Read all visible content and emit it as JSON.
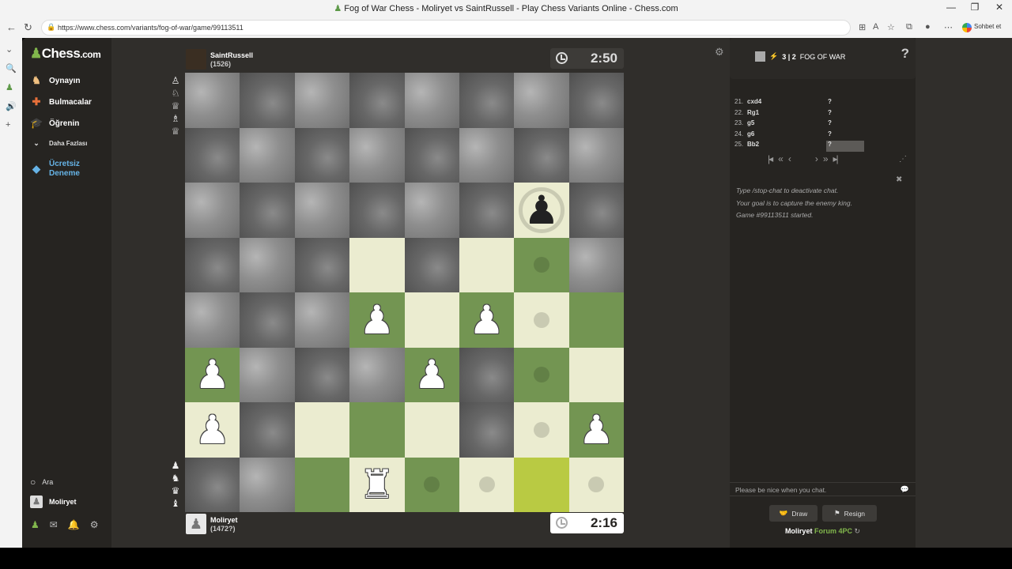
{
  "window": {
    "title": "Fog of War Chess - Moliryet vs SaintRussell - Play Chess Variants Online - Chess.com",
    "url": "https://www.chess.com/variants/fog-of-war/game/99113511",
    "chat_button": "Sohbet et"
  },
  "logo": {
    "text": "Chess",
    "suffix": ".com"
  },
  "nav": {
    "play": "Oynayın",
    "puzzles": "Bulmacalar",
    "learn": "Öğrenin",
    "more": "Daha Fazlası",
    "trial_line1": "Ücretsiz",
    "trial_line2": "Deneme",
    "search": "Ara",
    "user": "Moliryet"
  },
  "opponent": {
    "name": "SaintRussell",
    "rating": "(1526)",
    "clock": "2:50"
  },
  "me": {
    "name": "Moliryet",
    "rating": "(1472?)",
    "clock": "2:16"
  },
  "captured_top": [
    "♙",
    "♘",
    "♕",
    "♗",
    "♕"
  ],
  "captured_bottom": [
    "♟",
    "♞",
    "♛",
    "♝"
  ],
  "board": {
    "rows": [
      [
        "fog-l",
        "fog-d",
        "fog-l",
        "fog-d",
        "fog-l",
        "fog-d",
        "fog-l",
        "fog-d"
      ],
      [
        "fog-d",
        "fog-l",
        "fog-d",
        "fog-l",
        "fog-d",
        "fog-l",
        "fog-d",
        "fog-l"
      ],
      [
        "fog-l",
        "fog-d",
        "fog-l",
        "fog-d",
        "fog-l",
        "fog-d",
        "light",
        "fog-d"
      ],
      [
        "fog-d",
        "fog-l",
        "fog-d",
        "light",
        "fog-d",
        "light",
        "dark",
        "fog-l"
      ],
      [
        "fog-l",
        "fog-d",
        "fog-l",
        "dark",
        "light",
        "dark",
        "light",
        "dark"
      ],
      [
        "dark",
        "fog-l",
        "fog-d",
        "fog-l",
        "dark",
        "fog-d",
        "dark",
        "light"
      ],
      [
        "light",
        "fog-d",
        "light",
        "dark",
        "light",
        "fog-d",
        "light",
        "dark"
      ],
      [
        "fog-d",
        "fog-l",
        "dark",
        "light",
        "dark",
        "light",
        "hl",
        "light"
      ]
    ],
    "pieces": [
      {
        "r": 2,
        "c": 6,
        "glyph": "♟",
        "color": "b",
        "ring": true
      },
      {
        "r": 4,
        "c": 3,
        "glyph": "♟",
        "color": "w"
      },
      {
        "r": 4,
        "c": 5,
        "glyph": "♟",
        "color": "w"
      },
      {
        "r": 5,
        "c": 0,
        "glyph": "♟",
        "color": "w"
      },
      {
        "r": 5,
        "c": 4,
        "glyph": "♟",
        "color": "w"
      },
      {
        "r": 6,
        "c": 0,
        "glyph": "♟",
        "color": "w"
      },
      {
        "r": 6,
        "c": 7,
        "glyph": "♟",
        "color": "w"
      },
      {
        "r": 7,
        "c": 3,
        "glyph": "♜",
        "color": "w"
      }
    ],
    "hints": [
      [
        3,
        6
      ],
      [
        4,
        6
      ],
      [
        5,
        6
      ],
      [
        6,
        6
      ],
      [
        7,
        4
      ],
      [
        7,
        5
      ],
      [
        7,
        7
      ]
    ]
  },
  "game": {
    "time_control": "3 | 2",
    "variant": "FOG OF WAR",
    "help": "?"
  },
  "moves": [
    {
      "n": "21.",
      "w": "cxd4",
      "b": "?"
    },
    {
      "n": "22.",
      "w": "Rg1",
      "b": "?"
    },
    {
      "n": "23.",
      "w": "g5",
      "b": "?"
    },
    {
      "n": "24.",
      "w": "g6",
      "b": "?"
    },
    {
      "n": "25.",
      "w": "Bb2",
      "b": "?"
    }
  ],
  "chat": {
    "lines": [
      "Type /stop-chat to deactivate chat.",
      "Your goal is to capture the enemy king.",
      "Game #99113511 started."
    ],
    "placeholder": "Please be nice when you chat."
  },
  "actions": {
    "draw": "Draw",
    "resign": "Resign"
  },
  "footer": {
    "user": "Moliryet",
    "link": "Forum 4PC"
  }
}
